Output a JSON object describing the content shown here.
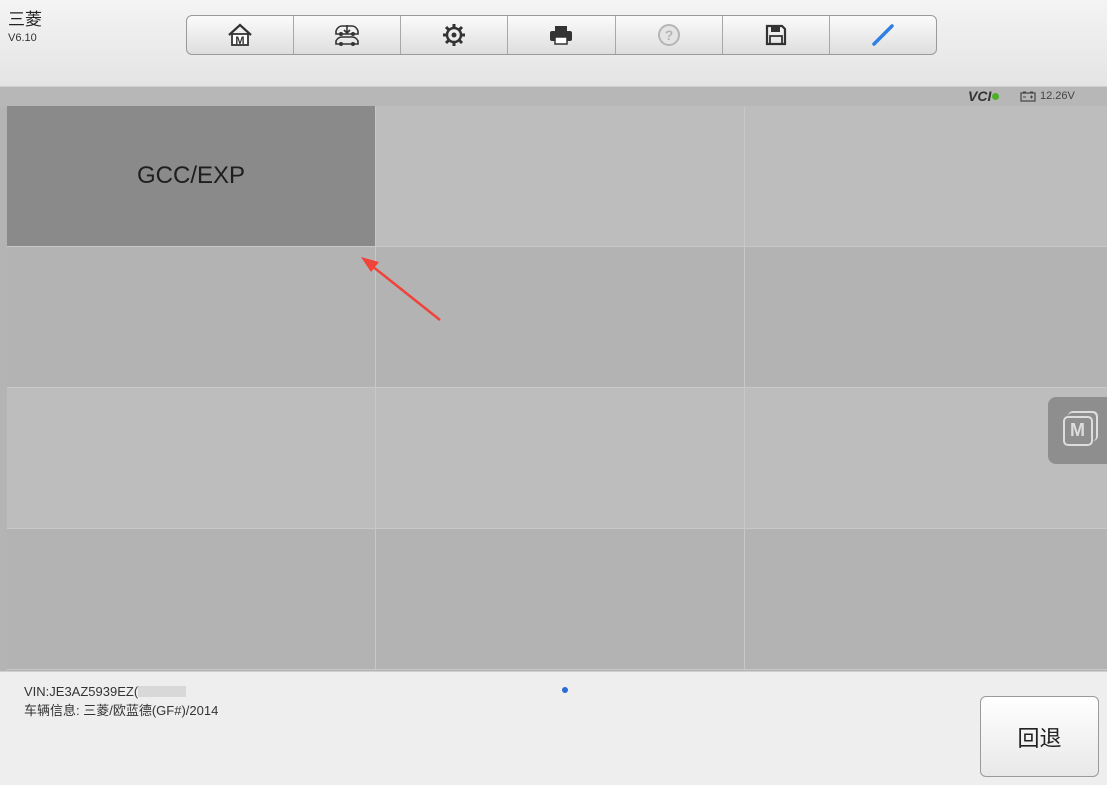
{
  "header": {
    "brand": "三菱",
    "version": "V6.10",
    "toolbar_icons": [
      "home-m-icon",
      "car-download-icon",
      "gear-icon",
      "printer-icon",
      "help-icon",
      "save-icon",
      "pencil-icon"
    ]
  },
  "status": {
    "vci_label": "VCI",
    "vci_color": "#4caf28",
    "voltage": "12.26V"
  },
  "grid": {
    "cells": [
      "GCC/EXP",
      "",
      "",
      "",
      "",
      "",
      "",
      "",
      "",
      "",
      "",
      ""
    ],
    "selected_index": 0
  },
  "floating": {
    "label": "M"
  },
  "footer": {
    "vin": "VIN:JE3AZ5939EZ(",
    "vehicle_info": "车辆信息: 三菱/欧蓝德(GF#)/2014",
    "back_label": "回退"
  },
  "annotation_color": "#f0433a"
}
